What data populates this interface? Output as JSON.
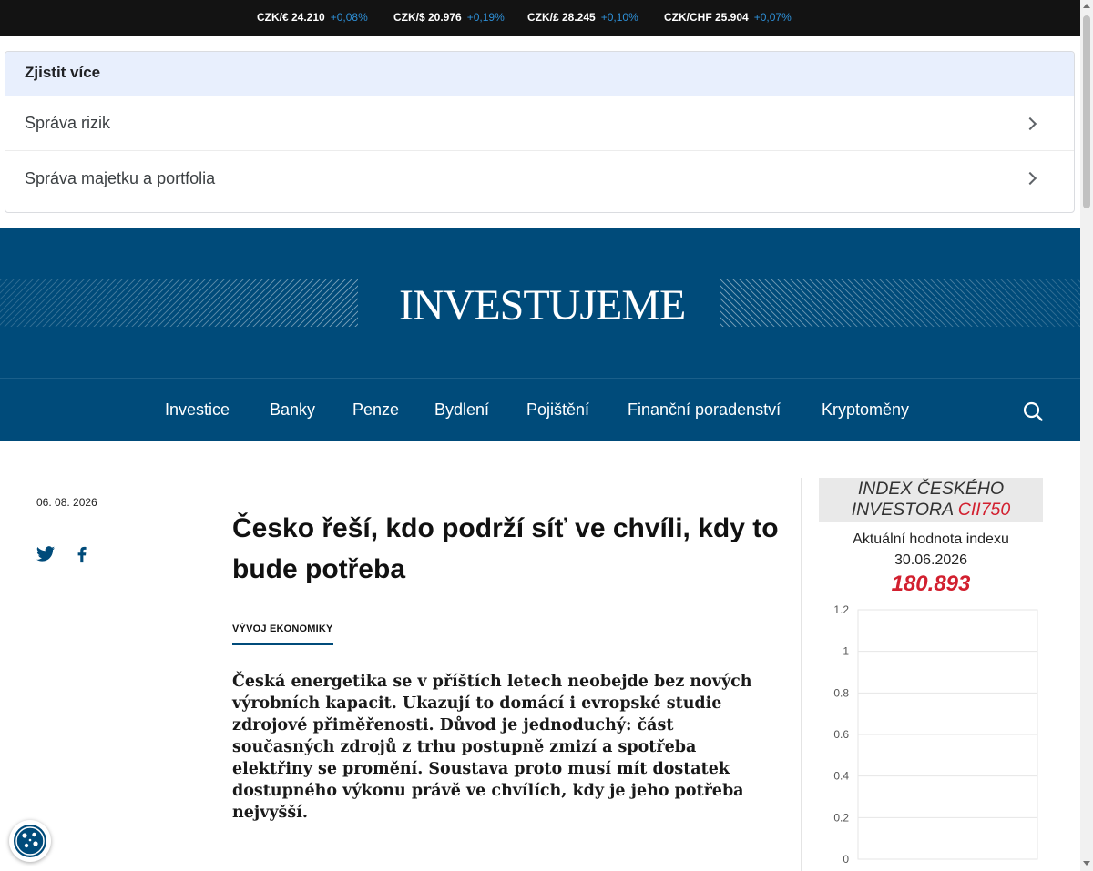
{
  "ticker": [
    {
      "pair": "CZK/€ 24.210",
      "change": "+0,08%"
    },
    {
      "pair": "CZK/$ 20.976",
      "change": "+0,19%"
    },
    {
      "pair": "CZK/£ 28.245",
      "change": "+0,10%"
    },
    {
      "pair": "CZK/CHF 25.904",
      "change": "+0,07%"
    }
  ],
  "ad": {
    "heading": "Zjistit více",
    "items": [
      "Správa rizik",
      "Správa majetku a portfolia"
    ]
  },
  "masthead": {
    "logo": "INVESTUJEME"
  },
  "nav": {
    "items": [
      "Investice",
      "Banky",
      "Penze",
      "Bydlení",
      "Pojištění",
      "Finanční poradenství",
      "Kryptoměny"
    ],
    "search_icon": "search-icon"
  },
  "article": {
    "date": "06. 08. 2026",
    "title": "Česko řeší, kdo podrží síť ve chvíli, kdy to bude potřeba",
    "category": "VÝVOJ EKONOMIKY",
    "lead": "Česká energetika se v příštích letech neobejde bez nových výrobních kapacit. Ukazují to domácí i evropské studie zdrojové přiměřenosti. Důvod je jednoduchý: část současných zdrojů z trhu postupně zmizí a spotřeba elektřiny se promění. Soustava proto musí mít dostatek dostupného výkonu právě ve chvílích, kdy je jeho potřeba nejvyšší.",
    "share_icons": [
      "twitter-icon",
      "facebook-icon"
    ]
  },
  "index": {
    "heading_line1": "INDEX ČESKÉHO",
    "heading_line2": "INVESTORA",
    "code": "CII750",
    "label": "Aktuální hodnota indexu",
    "date": "30.06.2026",
    "value": "180.893"
  },
  "chart_data": {
    "type": "line",
    "series": [],
    "ylim": [
      0,
      1.2
    ],
    "yticks": [
      "1.2",
      "1",
      "0.8",
      "0.6",
      "0.4",
      "0.2",
      "0"
    ],
    "grid": true
  },
  "colors": {
    "brand": "#004b7a",
    "accent_red": "#d2202f",
    "ticker_bg": "#131313",
    "ticker_change": "#2e8fd6"
  },
  "cookie_icon": "cookie-icon"
}
